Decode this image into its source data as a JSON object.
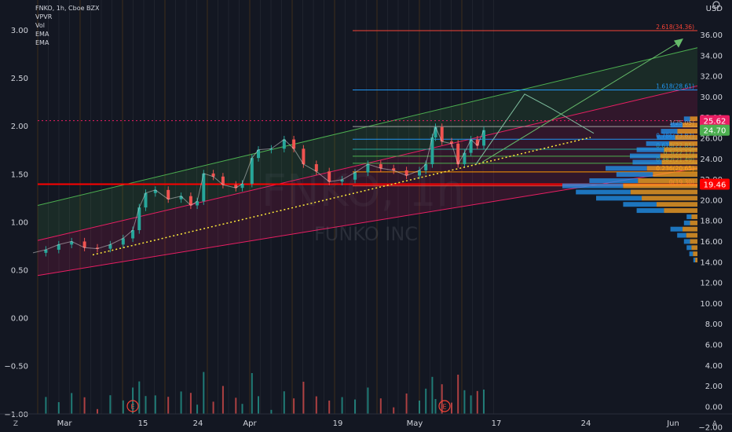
{
  "legend": {
    "symbol": "FNKO, 1h, Cboe BZX",
    "indicators": [
      "VPVR",
      "Vol",
      "EMA",
      "EMA"
    ]
  },
  "watermark": {
    "ticker": "FNKO, 1h",
    "name": "FUNKO INC"
  },
  "currency": "USD",
  "corner": {
    "left_icon": "Z",
    "right_icon": "A",
    "settings_icon": "gear-icon",
    "zoom_icon": "zoom-icon"
  },
  "colors": {
    "background": "#131722",
    "bull": "#26a69a",
    "bear": "#ef5350",
    "upper_channel": "#4caf50",
    "lower_channel": "#e91e63",
    "trendline": "#ffeb3b",
    "support_line": "#ff0000",
    "price_tag": "#e91e63",
    "ema_tag": "#4caf50",
    "support_tag": "#ff0000"
  },
  "chart_data": {
    "type": "line",
    "left_axis": {
      "ticks": [
        "3.00",
        "2.50",
        "2.00",
        "1.50",
        "1.00",
        "0.50",
        "0.00",
        "−0.50",
        "−1.00"
      ]
    },
    "right_axis": {
      "unit": "USD",
      "ticks": [
        "36.00",
        "34.00",
        "32.00",
        "30.00",
        "28.00",
        "26.00",
        "24.00",
        "22.00",
        "20.00",
        "18.00",
        "16.00",
        "14.00",
        "12.00",
        "10.00",
        "8.00",
        "6.00",
        "4.00",
        "2.00",
        "0.00",
        "−2.00"
      ]
    },
    "x_ticks": [
      "Mar",
      "15",
      "24",
      "Apr",
      "19",
      "May",
      "17",
      "24",
      "Jun"
    ],
    "price_tags": {
      "last": "25.62",
      "ema": "24.70",
      "support": "19.46"
    },
    "fibonacci": [
      {
        "label": "2.618(34.36)",
        "value": 34.36
      },
      {
        "label": "1.618(28.61)",
        "value": 28.61
      },
      {
        "label": "1(25.05)",
        "value": 25.05
      },
      {
        "label": "0.786(23.82)",
        "value": 23.82
      },
      {
        "label": "0.618(22.85)",
        "value": 22.85
      },
      {
        "label": "0.5(22.17)",
        "value": 22.17
      },
      {
        "label": "0.382(21.49)",
        "value": 21.49
      },
      {
        "label": "0.236(20.65)",
        "value": 20.65
      },
      {
        "label": "0(19.30)",
        "value": 19.3
      }
    ],
    "earnings_markers": [
      "E",
      "E"
    ],
    "price_series": [
      {
        "x": 0,
        "y": 12.8
      },
      {
        "x": 4,
        "y": 13.1
      },
      {
        "x": 8,
        "y": 13.6
      },
      {
        "x": 12,
        "y": 13.9
      },
      {
        "x": 16,
        "y": 13.3
      },
      {
        "x": 20,
        "y": 13.2
      },
      {
        "x": 24,
        "y": 13.6
      },
      {
        "x": 28,
        "y": 14.2
      },
      {
        "x": 31,
        "y": 15.0
      },
      {
        "x": 33,
        "y": 17.2
      },
      {
        "x": 35,
        "y": 18.6
      },
      {
        "x": 38,
        "y": 18.9
      },
      {
        "x": 42,
        "y": 18.0
      },
      {
        "x": 46,
        "y": 18.3
      },
      {
        "x": 49,
        "y": 17.4
      },
      {
        "x": 51,
        "y": 17.8
      },
      {
        "x": 53,
        "y": 20.5
      },
      {
        "x": 56,
        "y": 20.2
      },
      {
        "x": 59,
        "y": 19.4
      },
      {
        "x": 63,
        "y": 19.1
      },
      {
        "x": 65,
        "y": 19.5
      },
      {
        "x": 68,
        "y": 22.0
      },
      {
        "x": 70,
        "y": 22.8
      },
      {
        "x": 74,
        "y": 22.9
      },
      {
        "x": 78,
        "y": 23.8
      },
      {
        "x": 81,
        "y": 22.9
      },
      {
        "x": 84,
        "y": 21.4
      },
      {
        "x": 88,
        "y": 20.7
      },
      {
        "x": 92,
        "y": 19.7
      },
      {
        "x": 96,
        "y": 19.9
      },
      {
        "x": 100,
        "y": 20.6
      },
      {
        "x": 104,
        "y": 21.4
      },
      {
        "x": 108,
        "y": 21.0
      },
      {
        "x": 112,
        "y": 20.8
      },
      {
        "x": 116,
        "y": 20.3
      },
      {
        "x": 120,
        "y": 20.8
      },
      {
        "x": 122,
        "y": 21.4
      },
      {
        "x": 124,
        "y": 24.0
      },
      {
        "x": 125,
        "y": 25.0
      },
      {
        "x": 127,
        "y": 23.6
      },
      {
        "x": 130,
        "y": 23.4
      },
      {
        "x": 132,
        "y": 21.4
      },
      {
        "x": 134,
        "y": 22.5
      },
      {
        "x": 136,
        "y": 23.8
      },
      {
        "x": 138,
        "y": 23.2
      },
      {
        "x": 140,
        "y": 24.7
      }
    ],
    "volume_profile_right": [
      {
        "price": 25.8,
        "vol": 0.1
      },
      {
        "price": 25.2,
        "vol": 0.2
      },
      {
        "price": 24.6,
        "vol": 0.27
      },
      {
        "price": 24.0,
        "vol": 0.3
      },
      {
        "price": 23.4,
        "vol": 0.38
      },
      {
        "price": 22.8,
        "vol": 0.45
      },
      {
        "price": 22.2,
        "vol": 0.5
      },
      {
        "price": 21.6,
        "vol": 0.48
      },
      {
        "price": 21.0,
        "vol": 0.68
      },
      {
        "price": 20.4,
        "vol": 0.6
      },
      {
        "price": 19.8,
        "vol": 0.8
      },
      {
        "price": 19.3,
        "vol": 1.0
      },
      {
        "price": 18.7,
        "vol": 0.9
      },
      {
        "price": 18.1,
        "vol": 0.75
      },
      {
        "price": 17.5,
        "vol": 0.55
      },
      {
        "price": 16.9,
        "vol": 0.45
      },
      {
        "price": 16.3,
        "vol": 0.08
      },
      {
        "price": 15.7,
        "vol": 0.1
      },
      {
        "price": 15.1,
        "vol": 0.2
      },
      {
        "price": 14.5,
        "vol": 0.15
      },
      {
        "price": 13.9,
        "vol": 0.1
      },
      {
        "price": 13.3,
        "vol": 0.08
      },
      {
        "price": 12.7,
        "vol": 0.06
      },
      {
        "price": 12.1,
        "vol": 0.03
      }
    ]
  }
}
